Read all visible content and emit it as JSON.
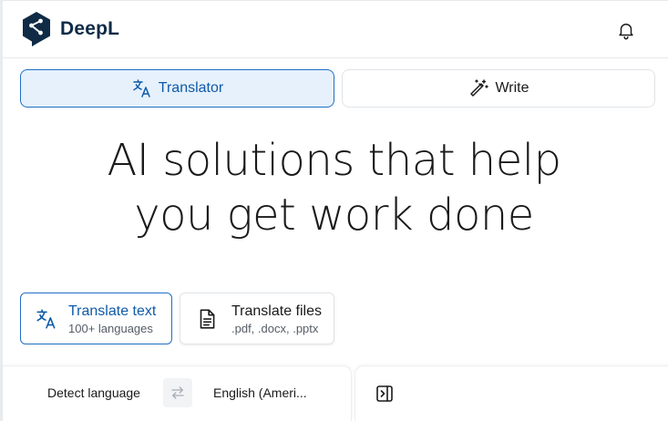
{
  "brand": {
    "name": "DeepL",
    "color": "#0f2b46"
  },
  "header": {
    "notification_icon": "bell-icon"
  },
  "tabs": [
    {
      "label": "Translator",
      "icon": "translate-icon",
      "active": true
    },
    {
      "label": "Write",
      "icon": "magic-wand-icon",
      "active": false
    }
  ],
  "hero": {
    "line1": "AI solutions that help",
    "line2": "you get work done"
  },
  "cards": [
    {
      "title": "Translate text",
      "subtitle": "100+ languages",
      "icon": "translate-icon",
      "active": true
    },
    {
      "title": "Translate files",
      "subtitle": ".pdf, .docx, .pptx",
      "icon": "document-icon",
      "active": false
    }
  ],
  "language_bar": {
    "source": "Detect language",
    "target": "English (Ameri...",
    "swap_icon": "swap-arrows-icon",
    "panel_icon": "panel-toggle-icon"
  },
  "colors": {
    "accent": "#1f6fc5",
    "accent_bg": "#e6f1fc",
    "accent_text": "#0f5aa8"
  }
}
